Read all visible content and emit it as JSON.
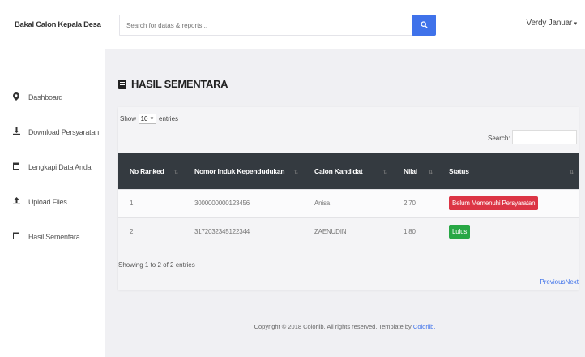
{
  "sidebar": {
    "brand": "Bakal Calon Kepala Desa",
    "items": [
      {
        "label": "Dashboard",
        "icon": "map-marker-icon"
      },
      {
        "label": "Download Persyaratan",
        "icon": "download-icon"
      },
      {
        "label": "Lengkapi Data Anda",
        "icon": "calendar-icon"
      },
      {
        "label": "Upload Files",
        "icon": "upload-icon"
      },
      {
        "label": "Hasil Sementara",
        "icon": "calendar-icon"
      }
    ]
  },
  "topbar": {
    "search_placeholder": "Search for datas & reports...",
    "user_name": "Verdy Januar"
  },
  "page": {
    "title": "HASIL SEMENTARA"
  },
  "table_controls": {
    "show_label": "Show",
    "entries_value": "10",
    "entries_label": "entries",
    "search_label": "Search:"
  },
  "table": {
    "columns": [
      "No Ranked",
      "Nomor Induk Kependudukan",
      "Calon Kandidat",
      "Nilai",
      "Status"
    ],
    "rows": [
      {
        "rank": "1",
        "nik": "3000000000123456",
        "name": "Anisa",
        "score": "2.70",
        "status": "Belum Memenuhi Persyaratan",
        "status_color": "#dc3545"
      },
      {
        "rank": "2",
        "nik": "3172032345122344",
        "name": "ZAENUDIN",
        "score": "1.80",
        "status": "Lulus",
        "status_color": "#28a745"
      }
    ]
  },
  "table_footer": {
    "info": "Showing 1 to 2 of 2 entries",
    "previous": "Previous",
    "next": "Next"
  },
  "footer": {
    "text": "Copyright © 2018 Colorlib. All rights reserved. Template by ",
    "link": "Colorlib."
  },
  "colors": {
    "accent": "#3f72ea",
    "table_header": "#343a40",
    "danger": "#dc3545",
    "success": "#28a745"
  }
}
